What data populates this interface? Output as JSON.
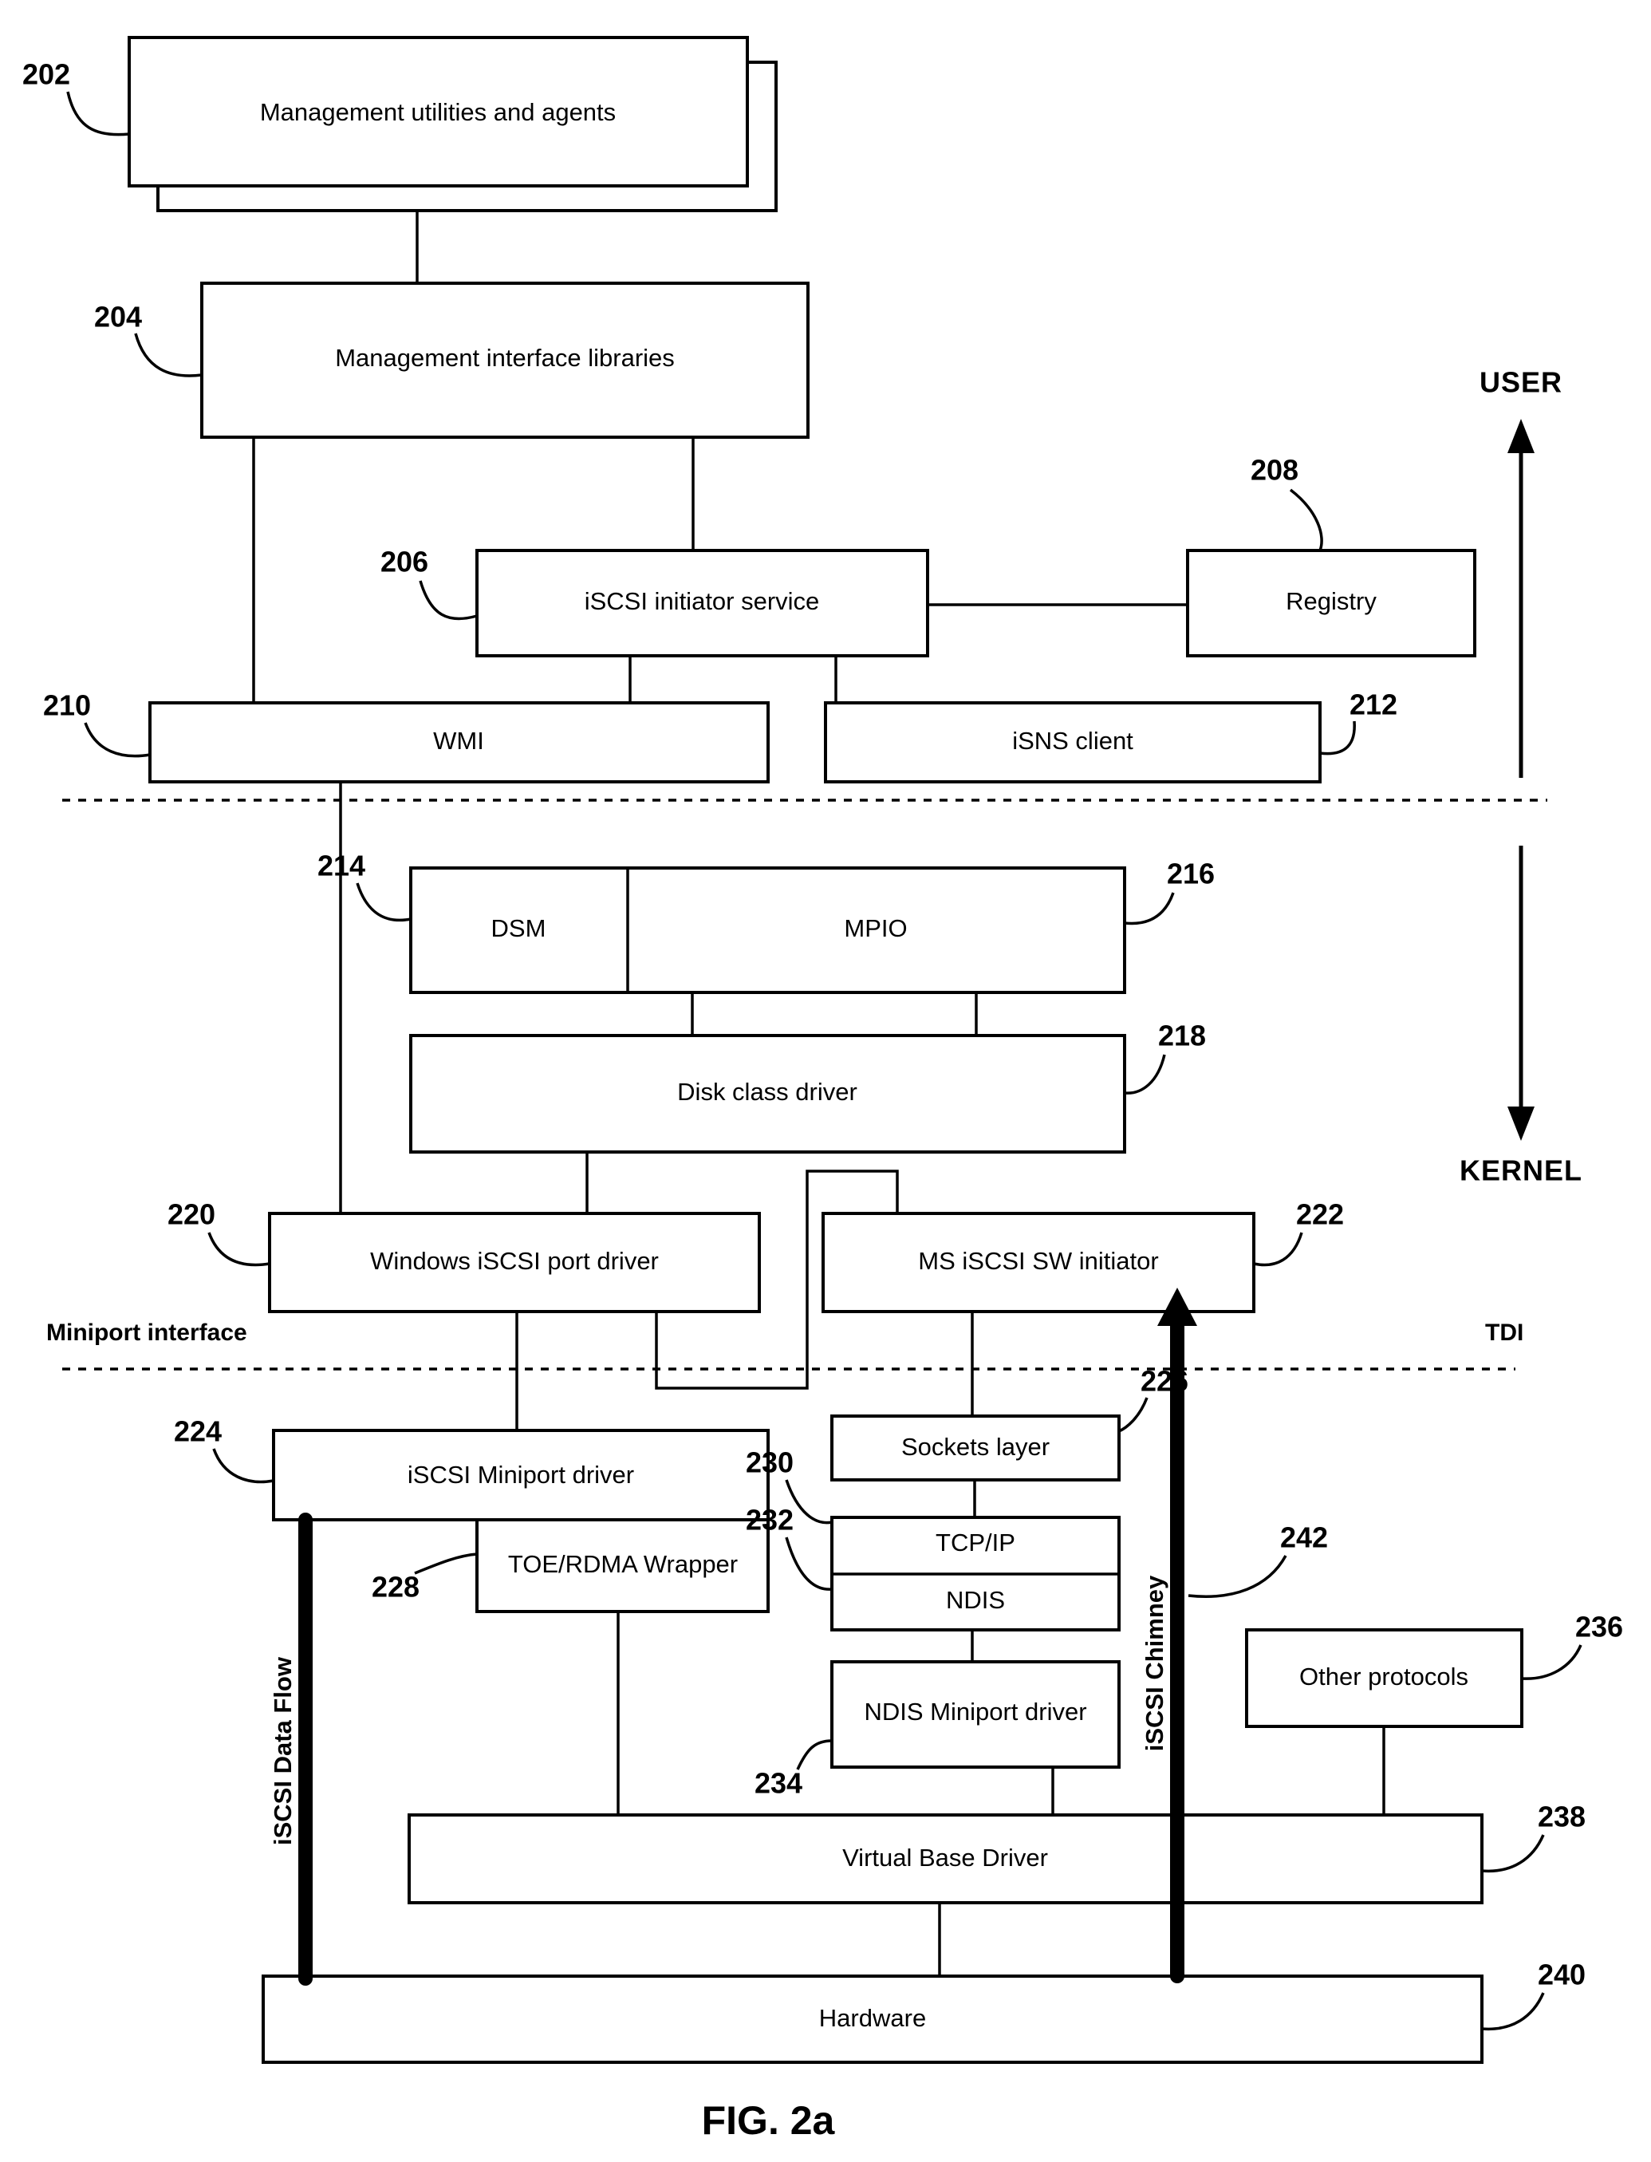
{
  "figure": {
    "caption": "FIG. 2a",
    "domain_boundaries": {
      "user_label": "USER",
      "kernel_label": "KERNEL",
      "miniport_interface_label": "Miniport interface",
      "tdi_label": "TDI"
    },
    "flow_bars": [
      {
        "id": "iscsi-data-flow",
        "label": "iSCSI Data Flow"
      },
      {
        "id": "iscsi-chimney",
        "label": "iSCSI Chimney",
        "ref": "242"
      }
    ],
    "blocks": [
      {
        "ref": "202",
        "label": "Management utilities and agents"
      },
      {
        "ref": "204",
        "label": "Management interface libraries"
      },
      {
        "ref": "206",
        "label": "iSCSI initiator service"
      },
      {
        "ref": "208",
        "label": "Registry"
      },
      {
        "ref": "210",
        "label": "WMI"
      },
      {
        "ref": "212",
        "label": "iSNS client"
      },
      {
        "ref": "214",
        "label": "DSM"
      },
      {
        "ref": "216",
        "label": "MPIO"
      },
      {
        "ref": "218",
        "label": "Disk class driver"
      },
      {
        "ref": "220",
        "label": "Windows iSCSI port driver"
      },
      {
        "ref": "222",
        "label": "MS iSCSI SW initiator"
      },
      {
        "ref": "224",
        "label": "iSCSI Miniport driver"
      },
      {
        "ref": "226",
        "label": "Sockets layer"
      },
      {
        "ref": "228",
        "label": "TOE/RDMA Wrapper"
      },
      {
        "ref": "230",
        "label": "TCP/IP"
      },
      {
        "ref": "232",
        "label": "NDIS"
      },
      {
        "ref": "234",
        "label": "NDIS Miniport driver"
      },
      {
        "ref": "236",
        "label": "Other protocols"
      },
      {
        "ref": "238",
        "label": "Virtual Base Driver"
      },
      {
        "ref": "240",
        "label": "Hardware"
      }
    ],
    "colors": {
      "stroke": "#000000",
      "fill": "#ffffff"
    }
  }
}
